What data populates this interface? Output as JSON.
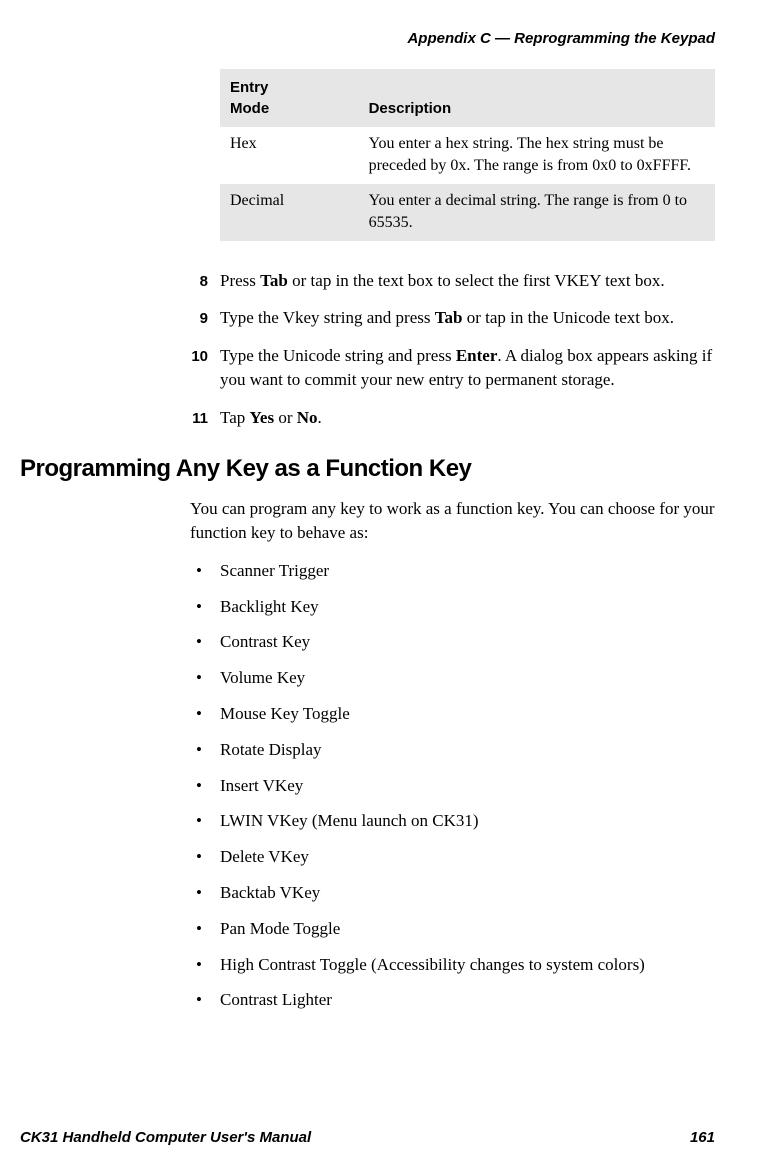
{
  "header": {
    "title": "Appendix C — Reprogramming the Keypad"
  },
  "table": {
    "headers": {
      "col1_line1": "Entry",
      "col1_line2": "Mode",
      "col2": "Description"
    },
    "rows": [
      {
        "mode": "Hex",
        "desc": "You enter a hex string. The hex string must be preceded by 0x. The range is from 0x0 to 0xFFFF."
      },
      {
        "mode": "Decimal",
        "desc": "You enter a decimal string. The range is from 0 to 65535."
      }
    ]
  },
  "steps": [
    {
      "num": "8",
      "pre": "Press ",
      "b1": "Tab",
      "post": " or tap in the text box to select the first VKEY text box."
    },
    {
      "num": "9",
      "pre": "Type the Vkey string and press ",
      "b1": "Tab",
      "post": " or tap in the Unicode text box."
    },
    {
      "num": "10",
      "pre": "Type the Unicode string and press ",
      "b1": "Enter",
      "post": ". A dialog box appears asking if you want to commit your new entry to permanent storage."
    },
    {
      "num": "11",
      "pre": "Tap ",
      "b1": "Yes",
      "mid": " or ",
      "b2": "No",
      "post": "."
    }
  ],
  "section": {
    "heading": "Programming Any Key as a Function Key",
    "para": "You can program any key to work as a function key. You can choose for your function key to behave as:"
  },
  "bullets": [
    "Scanner Trigger",
    "Backlight Key",
    "Contrast Key",
    "Volume Key",
    "Mouse Key Toggle",
    "Rotate Display",
    "Insert VKey",
    "LWIN VKey (Menu launch on CK31)",
    "Delete VKey",
    "Backtab VKey",
    "Pan Mode Toggle",
    "High Contrast Toggle (Accessibility changes to system colors)",
    "Contrast Lighter"
  ],
  "footer": {
    "left": "CK31 Handheld Computer User's Manual",
    "right": "161"
  }
}
